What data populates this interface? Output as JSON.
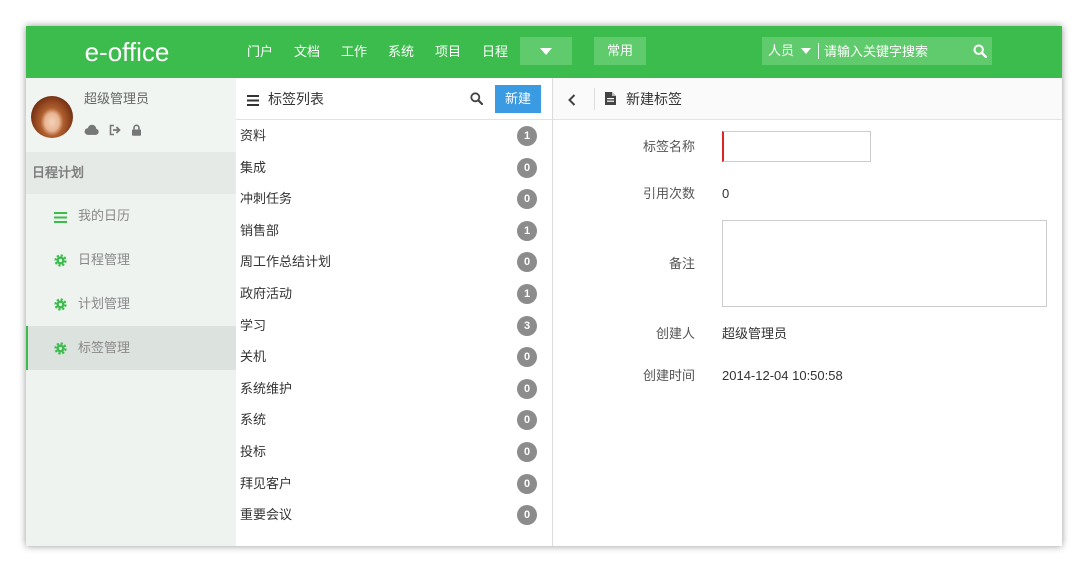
{
  "app": {
    "logo": "e-office"
  },
  "topnav": {
    "items": [
      {
        "label": "门户"
      },
      {
        "label": "文档"
      },
      {
        "label": "工作"
      },
      {
        "label": "系统"
      },
      {
        "label": "项目"
      },
      {
        "label": "日程"
      }
    ],
    "more_icon": "caret-down-icon",
    "common_label": "常用",
    "search": {
      "scope": "人员",
      "placeholder": "请输入关键字搜索",
      "icon": "search-icon"
    }
  },
  "user": {
    "name": "超级管理员",
    "icons": [
      "cloud-icon",
      "sign-out-icon",
      "lock-icon"
    ]
  },
  "sidebar": {
    "section_title": "日程计划",
    "items": [
      {
        "label": "我的日历",
        "icon": "list-icon",
        "active": false
      },
      {
        "label": "日程管理",
        "icon": "gear-icon",
        "active": false
      },
      {
        "label": "计划管理",
        "icon": "gear-icon",
        "active": false
      },
      {
        "label": "标签管理",
        "icon": "gear-icon",
        "active": true
      }
    ]
  },
  "tag_list": {
    "title": "标签列表",
    "new_label": "新建",
    "items": [
      {
        "name": "资料",
        "count": 1
      },
      {
        "name": "集成",
        "count": 0
      },
      {
        "name": "冲刺任务",
        "count": 0
      },
      {
        "name": "销售部",
        "count": 1
      },
      {
        "name": "周工作总结计划",
        "count": 0
      },
      {
        "name": "政府活动",
        "count": 1
      },
      {
        "name": "学习",
        "count": 3
      },
      {
        "name": "关机",
        "count": 0
      },
      {
        "name": "系统维护",
        "count": 0
      },
      {
        "name": "系统",
        "count": 0
      },
      {
        "name": "投标",
        "count": 0
      },
      {
        "name": "拜见客户",
        "count": 0
      },
      {
        "name": "重要会议",
        "count": 0
      }
    ]
  },
  "detail": {
    "title": "新建标签",
    "name": {
      "label": "标签名称",
      "value": ""
    },
    "ref_count": {
      "label": "引用次数",
      "value": "0"
    },
    "note": {
      "label": "备注",
      "value": ""
    },
    "creator": {
      "label": "创建人",
      "value": "超级管理员"
    },
    "created_time": {
      "label": "创建时间",
      "value": "2014-12-04 10:50:58"
    }
  },
  "colors": {
    "primary_green": "#3cbc4c",
    "light_green": "#60cb6c",
    "button_blue": "#3a9be2",
    "badge_gray": "#8c8c8c",
    "required_red": "#e02424"
  }
}
